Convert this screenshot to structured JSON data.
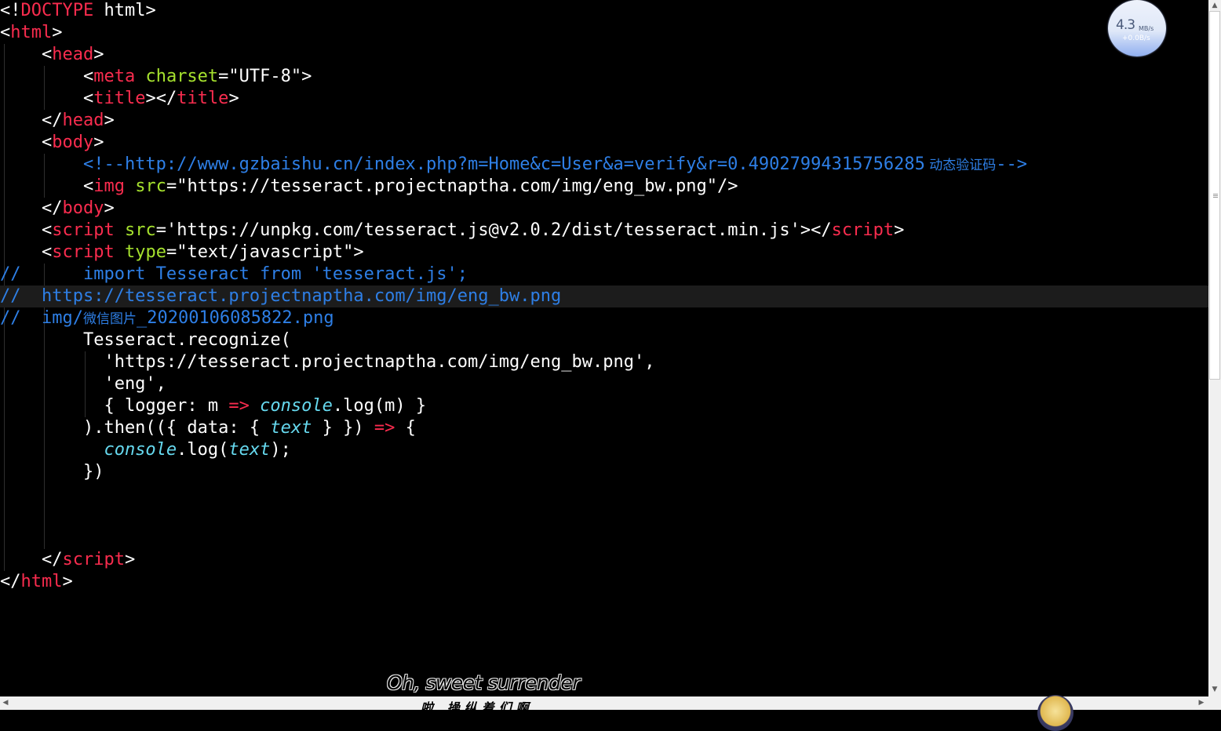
{
  "editor": {
    "lines": {
      "l1": [
        "<!",
        "DOCTYPE",
        " html>"
      ],
      "l2": [
        "<",
        "html",
        ">"
      ],
      "l3": [
        "    <",
        "head",
        ">"
      ],
      "l4": [
        "        <",
        "meta",
        " ",
        "charset",
        "=\"UTF-8\">"
      ],
      "l5": [
        "        <",
        "title",
        "></",
        "title",
        ">"
      ],
      "l6": [
        "    </",
        "head",
        ">"
      ],
      "l7": [
        "    <",
        "body",
        ">"
      ],
      "l8": [
        "        <!--http://www.gzbaishu.cn/index.php?m=Home&c=User&a=verify&r=0.49027994315756285",
        " 动态验证码",
        "-->"
      ],
      "l9": [
        "        <",
        "img",
        " ",
        "src",
        "=\"https://tesseract.projectnaptha.com/img/eng_bw.png\"/>"
      ],
      "l10": [
        "    </",
        "body",
        ">"
      ],
      "l11": [
        "    <",
        "script",
        " ",
        "src",
        "='https://unpkg.com/tesseract.js@v2.0.2/dist/tesseract.min.js'></",
        "script",
        ">"
      ],
      "l12": [
        "    <",
        "script",
        " ",
        "type",
        "=\"text/javascript\">"
      ],
      "l13": [
        "//      import Tesseract from 'tesseract.js';"
      ],
      "l14": [
        "//  https://tesseract.projectnaptha.com/img/eng_bw.png"
      ],
      "l15": [
        "//  img/",
        "微信图片",
        "_20200106085822.png"
      ],
      "l16": [
        "        Tesseract.recognize("
      ],
      "l17": [
        "          'https://tesseract.projectnaptha.com/img/eng_bw.png',"
      ],
      "l18": [
        "          'eng',"
      ],
      "l19": [
        "          { logger: m ",
        "=>",
        " ",
        "console",
        ".log(m) }"
      ],
      "l20": [
        "        ).then(({ data: { ",
        "text",
        " } }) ",
        "=>",
        " {"
      ],
      "l21": [
        "          ",
        "console",
        ".log(",
        "text",
        ");"
      ],
      "l22": [
        "        })"
      ],
      "l26": [
        "    </",
        "script",
        ">"
      ],
      "l27": [
        "</",
        "html",
        ">"
      ]
    }
  },
  "speed_widget": {
    "value": "4.3",
    "unit": "MB/s",
    "sub": "+0.0B/s"
  },
  "lyrics": {
    "line1": "Oh, sweet surrender",
    "line2": "啦  操纵着们啊"
  },
  "scroll": {
    "up": "▲",
    "down": "▼",
    "left": "◀",
    "right": "▶"
  }
}
